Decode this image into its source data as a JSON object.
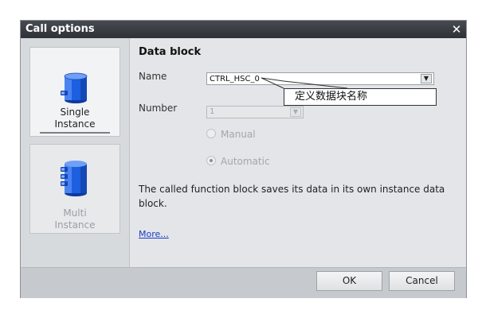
{
  "dialog": {
    "title": "Call options",
    "close_glyph": "✕"
  },
  "options": {
    "single": {
      "label": "Single\nInstance",
      "icon": "single-instance-db-icon",
      "selected": true
    },
    "multi": {
      "label": "Multi\nInstance",
      "icon": "multi-instance-db-icon",
      "selected": false
    }
  },
  "data_block": {
    "heading": "Data block",
    "name_label": "Name",
    "name_value": "CTRL_HSC_0",
    "number_label": "Number",
    "number_value": "1",
    "radio_manual": "Manual",
    "radio_automatic": "Automatic",
    "description": "The called function block saves its data in its own instance data block.",
    "more_link": "More..."
  },
  "annotation": {
    "text": "定义数据块名称"
  },
  "buttons": {
    "ok": "OK",
    "cancel": "Cancel"
  },
  "colors": {
    "titlebar": "#3a3e43",
    "panel": "#e3e5e8",
    "icon_blue": "#1c5fe0",
    "link": "#1a3cc8"
  }
}
